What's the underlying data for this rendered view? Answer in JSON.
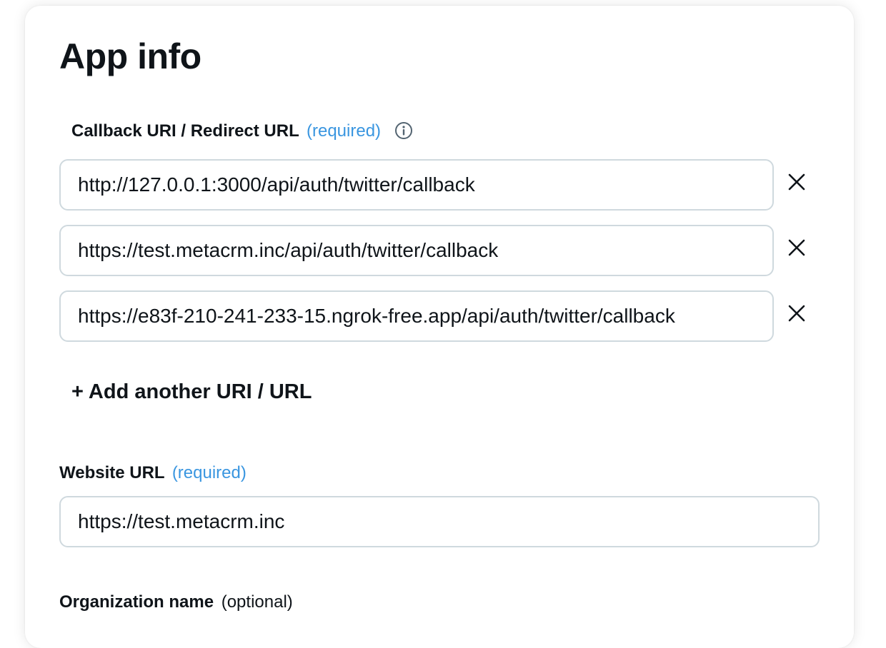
{
  "page": {
    "title": "App info"
  },
  "callback": {
    "label": "Callback URI / Redirect URL",
    "required": "(required)",
    "info_icon": "info-circle-icon",
    "remove_icon": "close-icon",
    "urls": [
      "http://127.0.0.1:3000/api/auth/twitter/callback",
      "https://test.metacrm.inc/api/auth/twitter/callback",
      "https://e83f-210-241-233-15.ngrok-free.app/api/auth/twitter/callback"
    ],
    "add_label": "+ Add another URI / URL"
  },
  "website": {
    "label": "Website URL",
    "required": "(required)",
    "value": "https://test.metacrm.inc"
  },
  "organization": {
    "label": "Organization name",
    "optional": "(optional)"
  },
  "colors": {
    "accent": "#3a96e0",
    "text": "#0f1419",
    "border": "#cfd9de"
  }
}
